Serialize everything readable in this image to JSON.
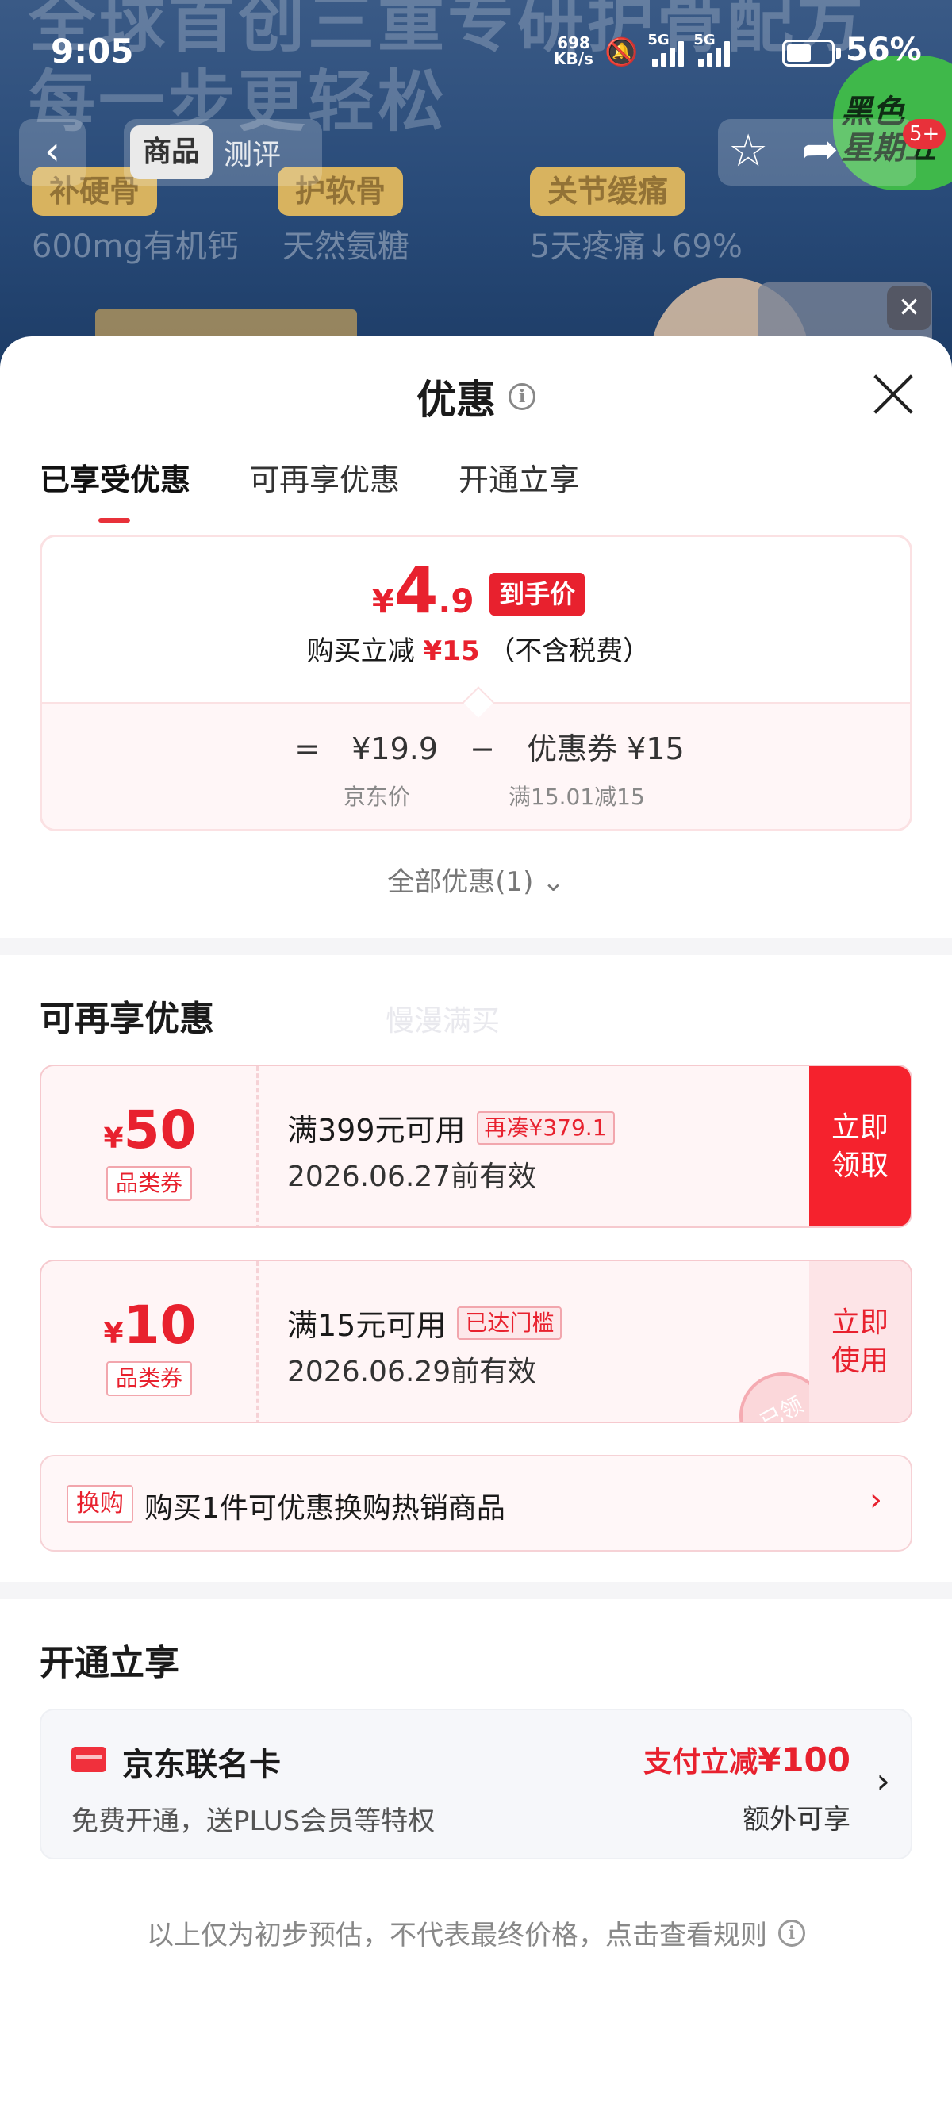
{
  "status_bar": {
    "time": "9:05",
    "net_speed": "698",
    "net_unit": "KB/s",
    "sig1_tag": "5G",
    "sig2_tag": "5G",
    "battery_level": 0.56,
    "battery_pct": "56%"
  },
  "hero": {
    "headline": "全球首创三重专研护骨配方\n每一步更轻松",
    "pills": [
      "补硬骨",
      "护软骨",
      "关节缓痛"
    ],
    "subs": [
      "600mg有机钙",
      "天然氨糖",
      "5天疼痛↓69%"
    ],
    "green_text": "黑色\n星期五",
    "colors": {
      "accent_green": "#3fb84a"
    }
  },
  "top_nav": {
    "back_icon": "chevron-left-icon",
    "tab_product": "商品",
    "tab_review": "测评",
    "badge": "5+"
  },
  "sheet": {
    "title": "优惠",
    "tabs": [
      "已享受优惠",
      "可再享优惠",
      "开通立享"
    ],
    "active_tab": 0,
    "summary": {
      "final_yen": "¥",
      "final_int": "4",
      "final_dec": ".9",
      "final_tag": "到手价",
      "discount_prefix": "购买立减",
      "discount_amount": "¥15",
      "discount_suffix": "（不含税费）",
      "jd_price": "¥19.9",
      "coupon_label": "优惠券 ¥15",
      "jd_price_label": "京东价",
      "coupon_rule": "满15.01减15"
    },
    "all_discounts": "全部优惠(1)",
    "more_section_title": "可再享优惠",
    "watermark": "慢漫满买",
    "coupons": [
      {
        "yen": "¥",
        "amount": "50",
        "type": "品类券",
        "condition": "满399元可用",
        "chip": "再凑¥379.1",
        "expiry": "2026.06.27前有效",
        "button": "立即\n领取"
      },
      {
        "yen": "¥",
        "amount": "10",
        "type": "品类券",
        "condition": "满15元可用",
        "chip": "已达门槛",
        "expiry": "2026.06.29前有效",
        "button": "立即\n使用",
        "stamp": "已领"
      }
    ],
    "exchange": {
      "tag": "换购",
      "text": "购买1件可优惠换购热销商品"
    },
    "open_section_title": "开通立享",
    "card": {
      "name": "京东联名卡",
      "desc": "免费开通，送PLUS会员等特权",
      "promo_prefix": "支付立减",
      "promo_amount": "¥100",
      "extra": "额外可享"
    },
    "footer": "以上仅为初步预估，不代表最终价格，点击查看规则"
  },
  "colors": {
    "accent_red": "#e8212e",
    "button_red": "#f5222d",
    "soft_pink": "#fff5f6"
  }
}
